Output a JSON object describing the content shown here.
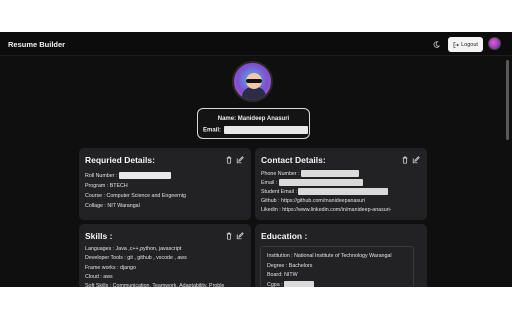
{
  "header": {
    "brand": "Resume Builder",
    "theme_icon": "moon-icon",
    "logout_label": "Logout",
    "logout_icon": "logout-icon"
  },
  "profile": {
    "name_label": "Name:",
    "name_value": "Manideep Anasuri",
    "email_label": "Email:"
  },
  "required_details": {
    "title": "Requried Details:",
    "roll_number_label": "Roll Number :",
    "program": "Program : BTECH",
    "course": "Course : Computer Science and Engeernig",
    "collage": "Collage : NIT Warangal"
  },
  "contact_details": {
    "title": "Contact Details:",
    "phone_label": "Phone Number :",
    "email_label": "Email :",
    "student_email_label": "Student Email :",
    "github": "Github : https://github.com/manideepanasuri",
    "linkedin": "Likedin : https://www.linkedin.com/in/manideep-anasuri-"
  },
  "skills": {
    "title": "Skills :",
    "languages": "Languages : Java ,c++,python, javascript",
    "developer_tools": "Developer Tools : git , github , vscode , aws",
    "frameworks": "Frame works : django",
    "cloud": "Cloud : aws",
    "soft_skills": "Soft Skills : Communication, Teamwork, Adaptability, Proble"
  },
  "education": {
    "title": "Education :",
    "institution": "Institution : National Institute of Technology Warangal",
    "degree": "Degree : Bachelors",
    "board": "Board: NITW",
    "cgpa_label": "Cgpa :"
  },
  "colors": {
    "background": "#0f0f10",
    "card": "#222224",
    "text": "#e4e4e4"
  }
}
